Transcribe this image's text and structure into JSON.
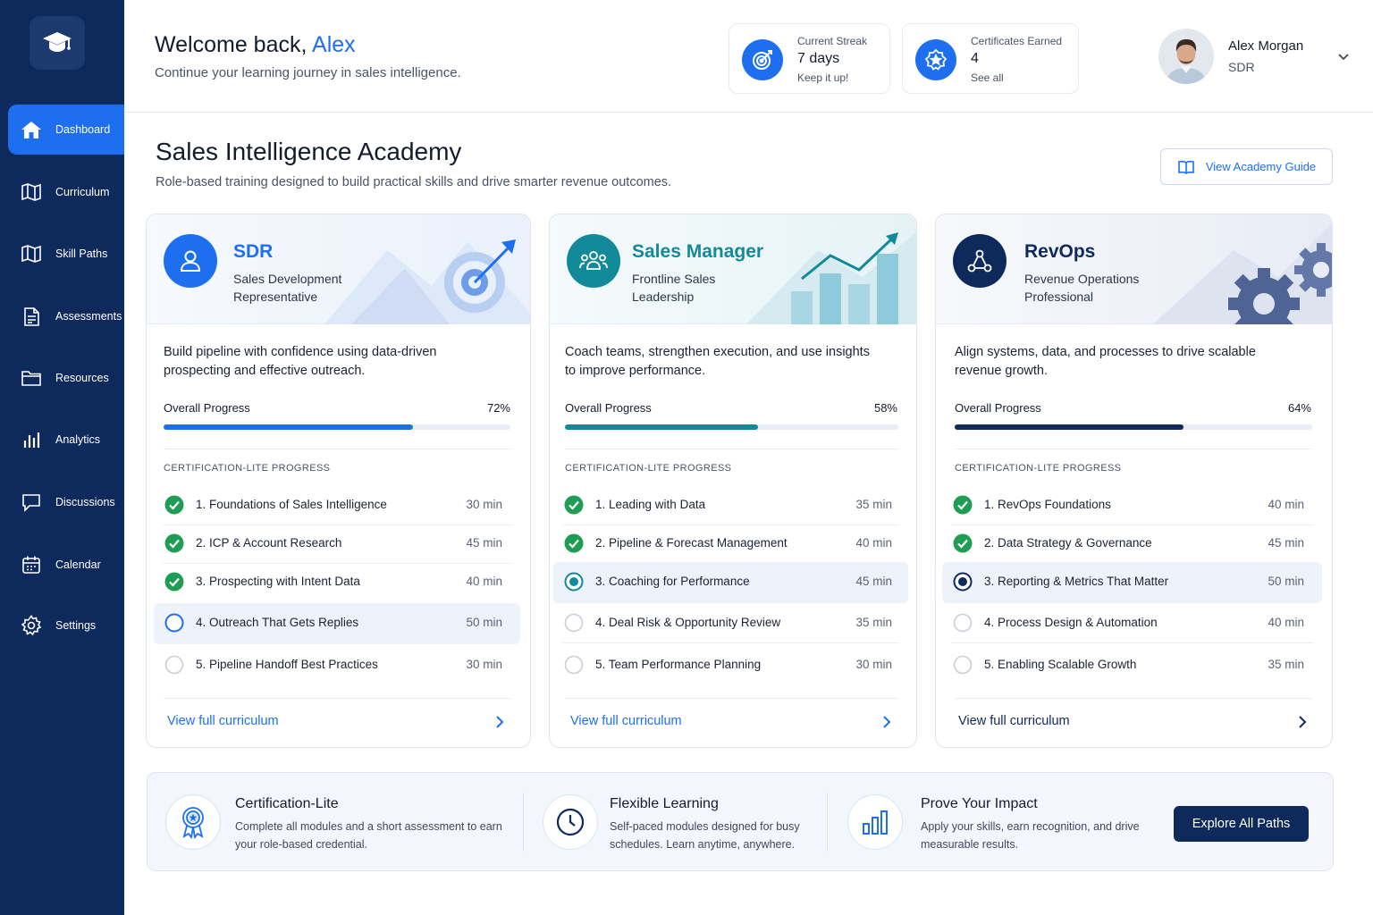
{
  "sidebar": {
    "items": [
      {
        "label": "Dashboard",
        "icon": "home-icon",
        "active": true
      },
      {
        "label": "Curriculum",
        "icon": "map-icon"
      },
      {
        "label": "Skill Paths",
        "icon": "map-icon"
      },
      {
        "label": "Assessments",
        "icon": "clipboard-icon"
      },
      {
        "label": "Resources",
        "icon": "folder-icon"
      },
      {
        "label": "Analytics",
        "icon": "bar-chart-icon"
      },
      {
        "label": "Discussions",
        "icon": "chat-icon"
      },
      {
        "label": "Calendar",
        "icon": "calendar-icon"
      },
      {
        "label": "Settings",
        "icon": "gear-icon"
      }
    ]
  },
  "header": {
    "welcome_prefix": "Welcome back, ",
    "welcome_name": "Alex",
    "subtitle": "Continue your learning journey in sales intelligence.",
    "streak": {
      "label": "Current Streak",
      "value": "7 days",
      "note": "Keep it up!"
    },
    "certificates": {
      "label": "Certificates Earned",
      "value": "4",
      "note": "See all"
    },
    "user": {
      "name": "Alex Morgan",
      "role": "SDR"
    }
  },
  "section": {
    "title": "Sales Intelligence Academy",
    "subtitle": "Role-based training designed to build practical skills and drive smarter revenue outcomes.",
    "guide_button": "View Academy Guide"
  },
  "roles": [
    {
      "title": "SDR",
      "subtitle": "Sales Development Representative",
      "description": "Build pipeline with confidence using data-driven prospecting and effective outreach.",
      "progress_label": "Overall Progress",
      "progress_pct_label": "72%",
      "progress": 0.72,
      "cert_heading": "CERTIFICATION-LITE PROGRESS",
      "modules": [
        {
          "name": "1. Foundations of Sales Intelligence",
          "duration": "30 min",
          "status": "done"
        },
        {
          "name": "2. ICP & Account Research",
          "duration": "45 min",
          "status": "done"
        },
        {
          "name": "3. Prospecting with Intent Data",
          "duration": "40 min",
          "status": "done"
        },
        {
          "name": "4. Outreach That Gets Replies",
          "duration": "50 min",
          "status": "current"
        },
        {
          "name": "5. Pipeline Handoff Best Practices",
          "duration": "30 min",
          "status": "todo"
        }
      ],
      "view_link": "View full curriculum",
      "accent": "#1e6ff0"
    },
    {
      "title": "Sales Manager",
      "subtitle": "Frontline Sales Leadership",
      "description": "Coach teams, strengthen execution, and use insights to improve performance.",
      "progress_label": "Overall Progress",
      "progress_pct_label": "58%",
      "progress": 0.58,
      "cert_heading": "CERTIFICATION-LITE PROGRESS",
      "modules": [
        {
          "name": "1. Leading with Data",
          "duration": "35 min",
          "status": "done"
        },
        {
          "name": "2. Pipeline & Forecast Management",
          "duration": "40 min",
          "status": "done"
        },
        {
          "name": "3. Coaching for Performance",
          "duration": "45 min",
          "status": "current"
        },
        {
          "name": "4. Deal Risk & Opportunity Review",
          "duration": "35 min",
          "status": "todo"
        },
        {
          "name": "5. Team Performance Planning",
          "duration": "30 min",
          "status": "todo"
        }
      ],
      "view_link": "View full curriculum",
      "accent": "#128a9a"
    },
    {
      "title": "RevOps",
      "subtitle": "Revenue Operations Professional",
      "description": "Align systems, data, and processes to drive scalable revenue growth.",
      "progress_label": "Overall Progress",
      "progress_pct_label": "64%",
      "progress": 0.64,
      "cert_heading": "CERTIFICATION-LITE PROGRESS",
      "modules": [
        {
          "name": "1. RevOps Foundations",
          "duration": "40 min",
          "status": "done"
        },
        {
          "name": "2. Data Strategy & Governance",
          "duration": "45 min",
          "status": "done"
        },
        {
          "name": "3. Reporting & Metrics That Matter",
          "duration": "50 min",
          "status": "current"
        },
        {
          "name": "4. Process Design & Automation",
          "duration": "40 min",
          "status": "todo"
        },
        {
          "name": "5. Enabling Scalable Growth",
          "duration": "35 min",
          "status": "todo"
        }
      ],
      "view_link": "View full curriculum",
      "accent": "#0e2a5c"
    }
  ],
  "banner": {
    "items": [
      {
        "title": "Certification-Lite",
        "text": "Complete all modules and a short assessment to earn your role-based credential.",
        "icon": "award-ribbon-icon"
      },
      {
        "title": "Flexible Learning",
        "text": "Self-paced modules designed for busy schedules. Learn anytime, anywhere.",
        "icon": "clock-icon"
      },
      {
        "title": "Prove Your Impact",
        "text": "Apply your skills, earn recognition, and drive measurable results.",
        "icon": "bar-chart-icon"
      }
    ],
    "cta": "Explore All Paths"
  },
  "colors": {
    "sidebar_bg": "#0e2a5c",
    "primary": "#1e6ff0",
    "teal": "#128a9a",
    "navy": "#0e2a5c",
    "success": "#1f9d55"
  }
}
